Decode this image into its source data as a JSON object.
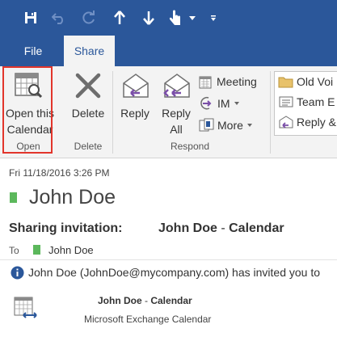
{
  "qat": {
    "icons": [
      "save-icon",
      "undo-icon",
      "redo-icon",
      "up-arrow-icon",
      "down-arrow-icon",
      "touch-mode-icon",
      "dropdown-icon",
      "customize-icon"
    ]
  },
  "tabs": [
    {
      "label": "File"
    },
    {
      "label": "Share"
    }
  ],
  "ribbon": {
    "open_group": {
      "button_line1": "Open this",
      "button_line2": "Calendar",
      "label": "Open"
    },
    "delete_group": {
      "button": "Delete",
      "label": "Delete"
    },
    "respond_group": {
      "reply": "Reply",
      "reply_all_line1": "Reply",
      "reply_all_line2": "All",
      "meeting": "Meeting",
      "im": "IM",
      "more": "More",
      "label": "Respond"
    },
    "quick_steps": [
      "Old Voi",
      "Team E",
      "Reply &"
    ]
  },
  "message": {
    "date": "Fri 11/18/2016 3:26 PM",
    "sender": "John Doe",
    "subject_label": "Sharing invitation:",
    "subject_name": "John Doe",
    "subject_sep": " - ",
    "subject_cal": "Calendar",
    "to_label": "To",
    "to_name": "John Doe",
    "info_text": "John Doe (JohnDoe@mycompany.com) has invited you to",
    "attachment_name": "John Doe",
    "attachment_sep": " - ",
    "attachment_cal": "Calendar",
    "attachment_type": "Microsoft Exchange Calendar"
  },
  "colors": {
    "ribbon_blue": "#2b579a",
    "presence_green": "#5cb85c",
    "highlight_red": "#e2352b",
    "purple_arrow": "#7a4ea8"
  }
}
